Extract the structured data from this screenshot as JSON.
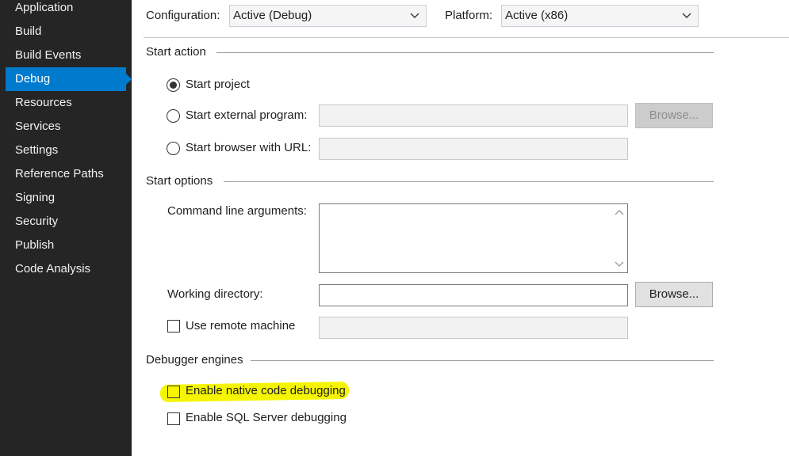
{
  "sidebar": {
    "items": [
      {
        "label": "Application",
        "active": false
      },
      {
        "label": "Build",
        "active": false
      },
      {
        "label": "Build Events",
        "active": false
      },
      {
        "label": "Debug",
        "active": true
      },
      {
        "label": "Resources",
        "active": false
      },
      {
        "label": "Services",
        "active": false
      },
      {
        "label": "Settings",
        "active": false
      },
      {
        "label": "Reference Paths",
        "active": false
      },
      {
        "label": "Signing",
        "active": false
      },
      {
        "label": "Security",
        "active": false
      },
      {
        "label": "Publish",
        "active": false
      },
      {
        "label": "Code Analysis",
        "active": false
      }
    ]
  },
  "toolbar": {
    "configuration_label": "Configuration:",
    "configuration_value": "Active (Debug)",
    "platform_label": "Platform:",
    "platform_value": "Active (x86)"
  },
  "start_action": {
    "heading": "Start action",
    "start_project_label": "Start project",
    "start_external_label": "Start external program:",
    "external_browse_label": "Browse...",
    "start_browser_label": "Start browser with URL:",
    "selected": "start_project"
  },
  "start_options": {
    "heading": "Start options",
    "command_line_label": "Command line arguments:",
    "working_dir_label": "Working directory:",
    "working_dir_browse_label": "Browse...",
    "remote_machine_label": "Use remote machine",
    "remote_machine_checked": false
  },
  "debugger_engines": {
    "heading": "Debugger engines",
    "native_label": "Enable native code debugging",
    "native_checked": false,
    "sql_label": "Enable SQL Server debugging",
    "sql_checked": false
  },
  "colors": {
    "sidebar_bg": "#252526",
    "active_item": "#007acc",
    "highlight": "#f5f500"
  }
}
